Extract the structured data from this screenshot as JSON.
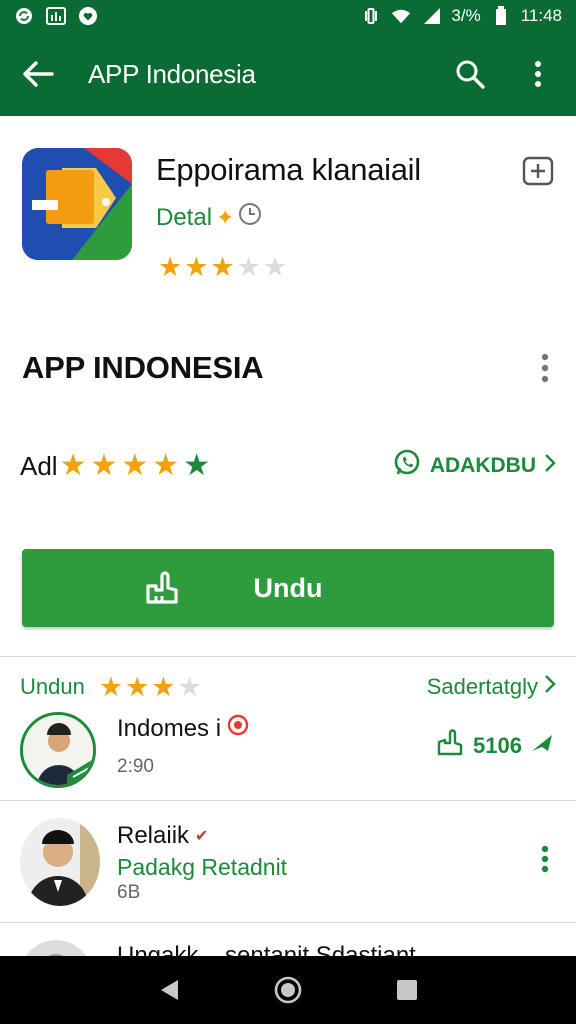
{
  "status_bar": {
    "left_icons": [
      "sync-icon",
      "gallery-icon",
      "heart-icon"
    ],
    "right_icons": [
      "vibrate-icon",
      "wifi-icon",
      "signal-icon"
    ],
    "battery": "3/%",
    "time": "11:48"
  },
  "app_bar": {
    "title": "APP Indonesia",
    "icons": [
      "back-arrow-icon",
      "search-icon",
      "more-vert-icon"
    ]
  },
  "app": {
    "name": "Eppoirama klanaiail",
    "developer": "Detal",
    "rating": 3,
    "rating_max": 5,
    "colors": {
      "accent": "#1b8a3a",
      "star": "#f2a20c"
    }
  },
  "section": {
    "heading": "APP INDONESIA"
  },
  "rating_row": {
    "label": "Adl",
    "stars": 5,
    "whatsapp_label": "ADAKDBU"
  },
  "install": {
    "label": "Undu"
  },
  "reviews": {
    "label": "Undun",
    "rating": 3,
    "link_label": "Sadertatgly",
    "items": [
      {
        "title": "Indomes i",
        "meta": "2:90",
        "count": "5106"
      },
      {
        "title": "Relaiik",
        "subtitle": "Padakg Retadnit",
        "meta": "6B"
      },
      {
        "title": "Ungakk... sentanit Sdastiant"
      }
    ]
  }
}
